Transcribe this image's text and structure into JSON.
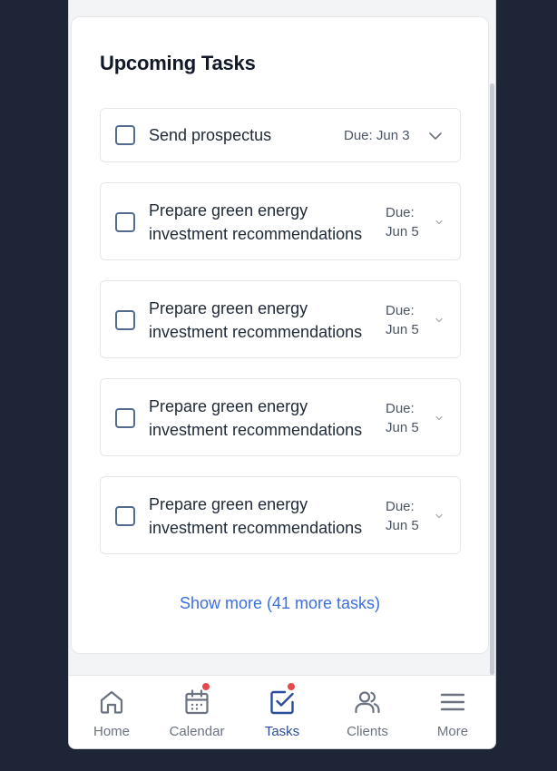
{
  "card": {
    "title": "Upcoming Tasks",
    "show_more": "Show more (41 more tasks)"
  },
  "tasks": [
    {
      "title": "Send prospectus",
      "due": "Due: Jun 3"
    },
    {
      "title_line1": "Prepare green energy",
      "title_line2": "investment recommendations",
      "due_line1": "Due:",
      "due_line2": "Jun 5"
    },
    {
      "title_line1": "Prepare green energy",
      "title_line2": "investment recommendations",
      "due_line1": "Due:",
      "due_line2": "Jun 5"
    },
    {
      "title_line1": "Prepare green energy",
      "title_line2": "investment recommendations",
      "due_line1": "Due:",
      "due_line2": "Jun 5"
    },
    {
      "title_line1": "Prepare green energy",
      "title_line2": "investment recommendations",
      "due_line1": "Due:",
      "due_line2": "Jun 5"
    }
  ],
  "nav": [
    {
      "label": "Home",
      "icon": "home-icon",
      "badge": false,
      "active": false
    },
    {
      "label": "Calendar",
      "icon": "calendar-icon",
      "badge": true,
      "active": false
    },
    {
      "label": "Tasks",
      "icon": "tasks-icon",
      "badge": true,
      "active": true
    },
    {
      "label": "Clients",
      "icon": "clients-icon",
      "badge": false,
      "active": false
    },
    {
      "label": "More",
      "icon": "menu-icon",
      "badge": false,
      "active": false
    }
  ],
  "colors": {
    "accent": "#2a4d9b",
    "link": "#3b6fe0",
    "badge": "#e5484d",
    "page_bg": "#1e2536"
  }
}
